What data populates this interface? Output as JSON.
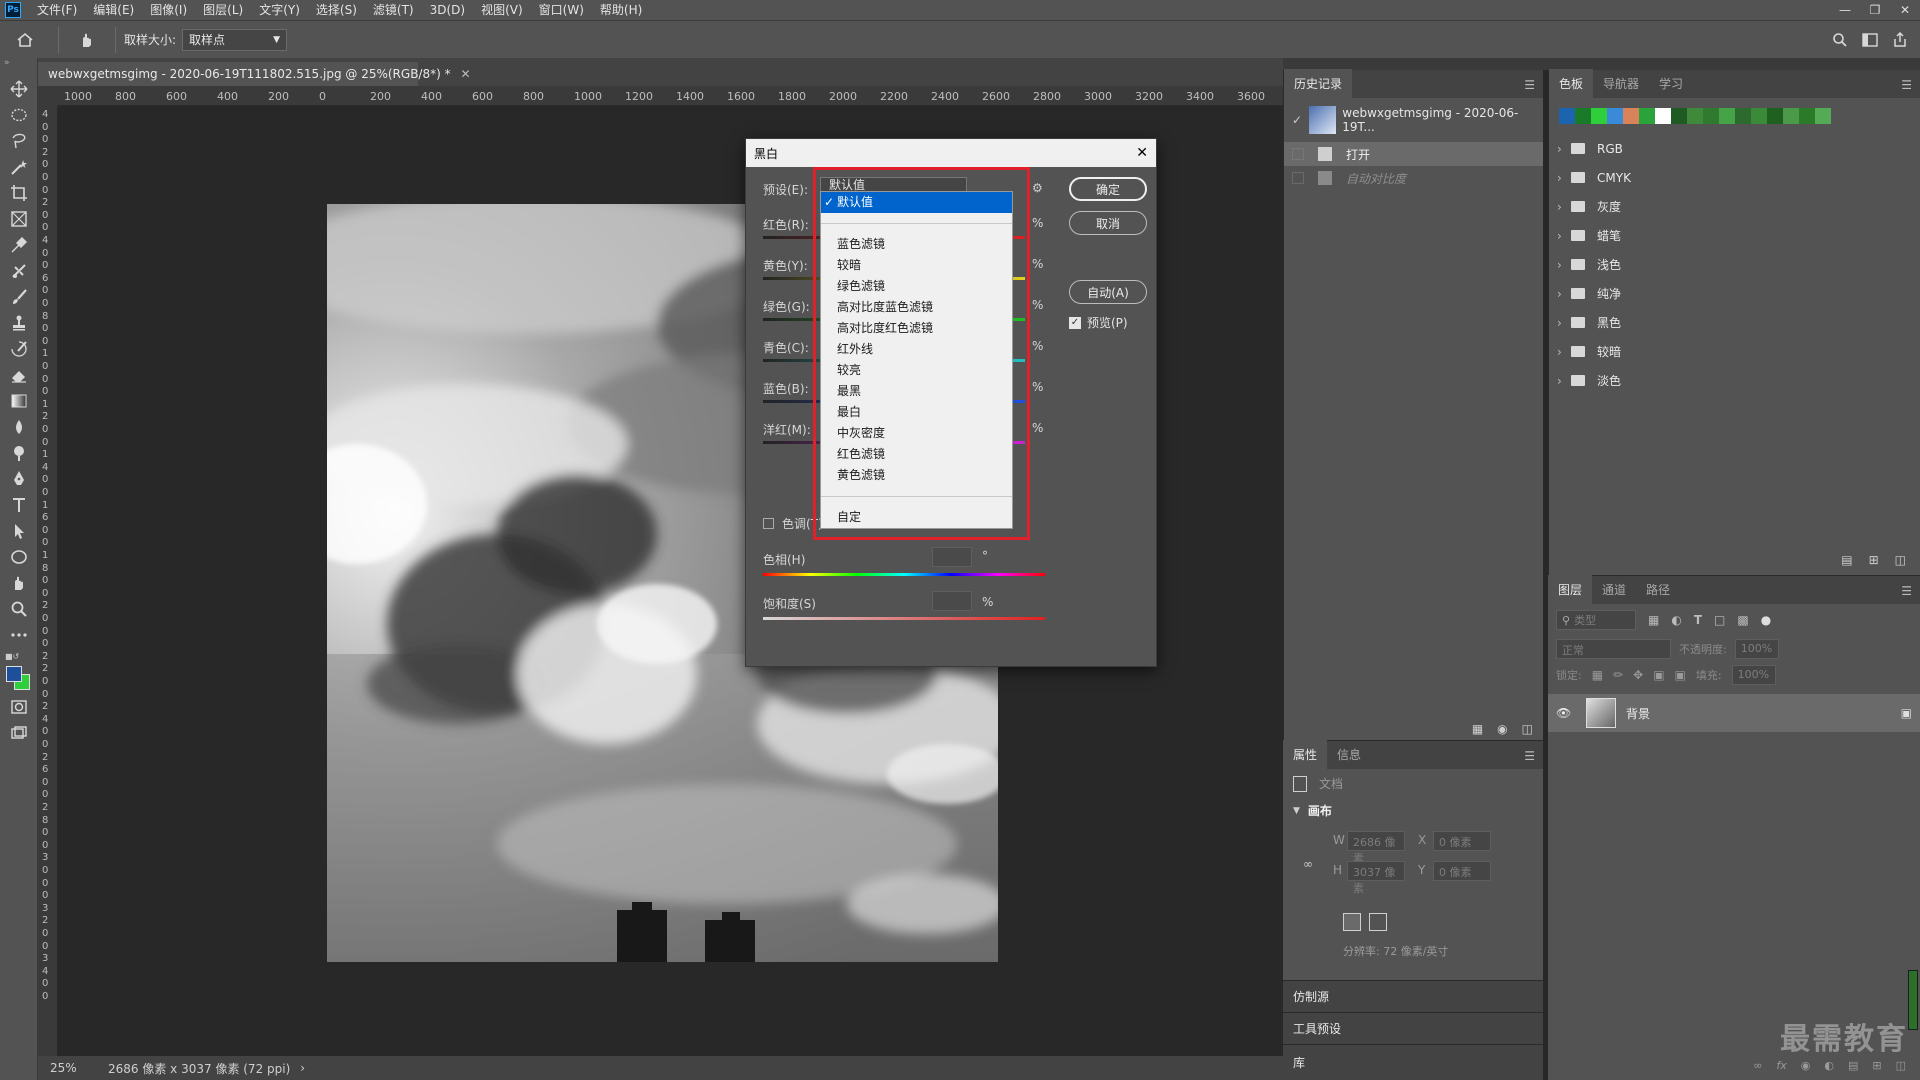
{
  "menubar": {
    "items": [
      "文件(F)",
      "编辑(E)",
      "图像(I)",
      "图层(L)",
      "文字(Y)",
      "选择(S)",
      "滤镜(T)",
      "3D(D)",
      "视图(V)",
      "窗口(W)",
      "帮助(H)"
    ]
  },
  "options": {
    "sample_size_label": "取样大小:",
    "sample_size_value": "取样点"
  },
  "document": {
    "tab_title": "webwxgetmsgimg - 2020-06-19T111802.515.jpg @ 25%(RGB/8*) *",
    "ruler_top": [
      "1000",
      "800",
      "600",
      "400",
      "200",
      "0",
      "200",
      "400",
      "600",
      "800",
      "1000",
      "1200",
      "1400",
      "1600",
      "1800",
      "2000",
      "2200",
      "2400",
      "2600",
      "2800",
      "3000",
      "3200",
      "3400",
      "3600"
    ],
    "ruler_left": [
      "4",
      "0",
      "0",
      "2",
      "0",
      "0",
      "0",
      "2",
      "0",
      "0",
      "4",
      "0",
      "0",
      "6",
      "0",
      "0",
      "8",
      "0",
      "0",
      "1",
      "0",
      "0",
      "0",
      "1",
      "2",
      "0",
      "0",
      "1",
      "4",
      "0",
      "0",
      "1",
      "6",
      "0",
      "0",
      "1",
      "8",
      "0",
      "0",
      "2",
      "0",
      "0",
      "0",
      "2",
      "2",
      "0",
      "0",
      "2",
      "4",
      "0",
      "0",
      "2",
      "6",
      "0",
      "0",
      "2",
      "8",
      "0",
      "0",
      "3",
      "0",
      "0",
      "0",
      "3",
      "2",
      "0",
      "0",
      "3",
      "4",
      "0",
      "0"
    ],
    "zoom": "25%",
    "info": "2686 像素 x 3037 像素 (72 ppi)"
  },
  "history": {
    "tabs": [
      "历史记录"
    ],
    "snapshot": "webwxgetmsgimg - 2020-06-19T...",
    "steps": [
      "打开",
      "自动对比度"
    ]
  },
  "properties": {
    "tabs": [
      "属性",
      "信息"
    ],
    "doc_label": "文档",
    "section": "画布",
    "w_label": "W",
    "w_value": "2686 像素",
    "h_label": "H",
    "h_value": "3037 像素",
    "x_label": "X",
    "x_value": "0 像素",
    "y_label": "Y",
    "y_value": "0 像素",
    "resolution": "分辨率: 72 像素/英寸"
  },
  "collapsed_panels": [
    "仿制源",
    "工具预设",
    "库"
  ],
  "swatches": {
    "tabs": [
      "色板",
      "导航器",
      "学习"
    ],
    "colors": [
      "#1d64b0",
      "#1a7a2a",
      "#2ecf3a",
      "#3a8ad8",
      "#d8835a",
      "#29a33a",
      "#ffffff",
      "#1e5a22",
      "#3f8a3a",
      "#2f7a2f",
      "#47a347",
      "#2d6a2d",
      "#3a8a3a",
      "#1f5f1f",
      "#4a9a4a",
      "#2a7a2a",
      "#55aa55"
    ],
    "folders": [
      "RGB",
      "CMYK",
      "灰度",
      "蜡笔",
      "浅色",
      "纯净",
      "黑色",
      "较暗",
      "淡色"
    ]
  },
  "layers": {
    "tabs": [
      "图层",
      "通道",
      "路径"
    ],
    "filter_placeholder": "类型",
    "blend_mode": "正常",
    "opacity_label": "不透明度:",
    "opacity_value": "100%",
    "lock_label": "锁定:",
    "fill_label": "填充:",
    "fill_value": "100%",
    "layer_name": "背景"
  },
  "bw_dialog": {
    "title": "黑白",
    "preset_label": "预设(E):",
    "preset_value": "默认值",
    "sliders": [
      {
        "label": "红色(R):",
        "unit": "%"
      },
      {
        "label": "黄色(Y):",
        "unit": "%"
      },
      {
        "label": "绿色(G):",
        "unit": "%"
      },
      {
        "label": "青色(C):",
        "unit": "%"
      },
      {
        "label": "蓝色(B):",
        "unit": "%"
      },
      {
        "label": "洋红(M):",
        "unit": "%"
      }
    ],
    "tint_label": "色调(T)",
    "hue_label": "色相(H)",
    "hue_unit": "°",
    "sat_label": "饱和度(S)",
    "sat_unit": "%",
    "ok": "确定",
    "cancel": "取消",
    "auto": "自动(A)",
    "preview": "预览(P)",
    "preview_checked": true
  },
  "preset_list": {
    "selected": "默认值",
    "group1": [
      "蓝色滤镜",
      "较暗",
      "绿色滤镜",
      "高对比度蓝色滤镜",
      "高对比度红色滤镜",
      "红外线",
      "较亮",
      "最黑",
      "最白",
      "中灰密度",
      "红色滤镜",
      "黄色滤镜"
    ],
    "custom": "自定"
  },
  "watermark": "最需教育"
}
